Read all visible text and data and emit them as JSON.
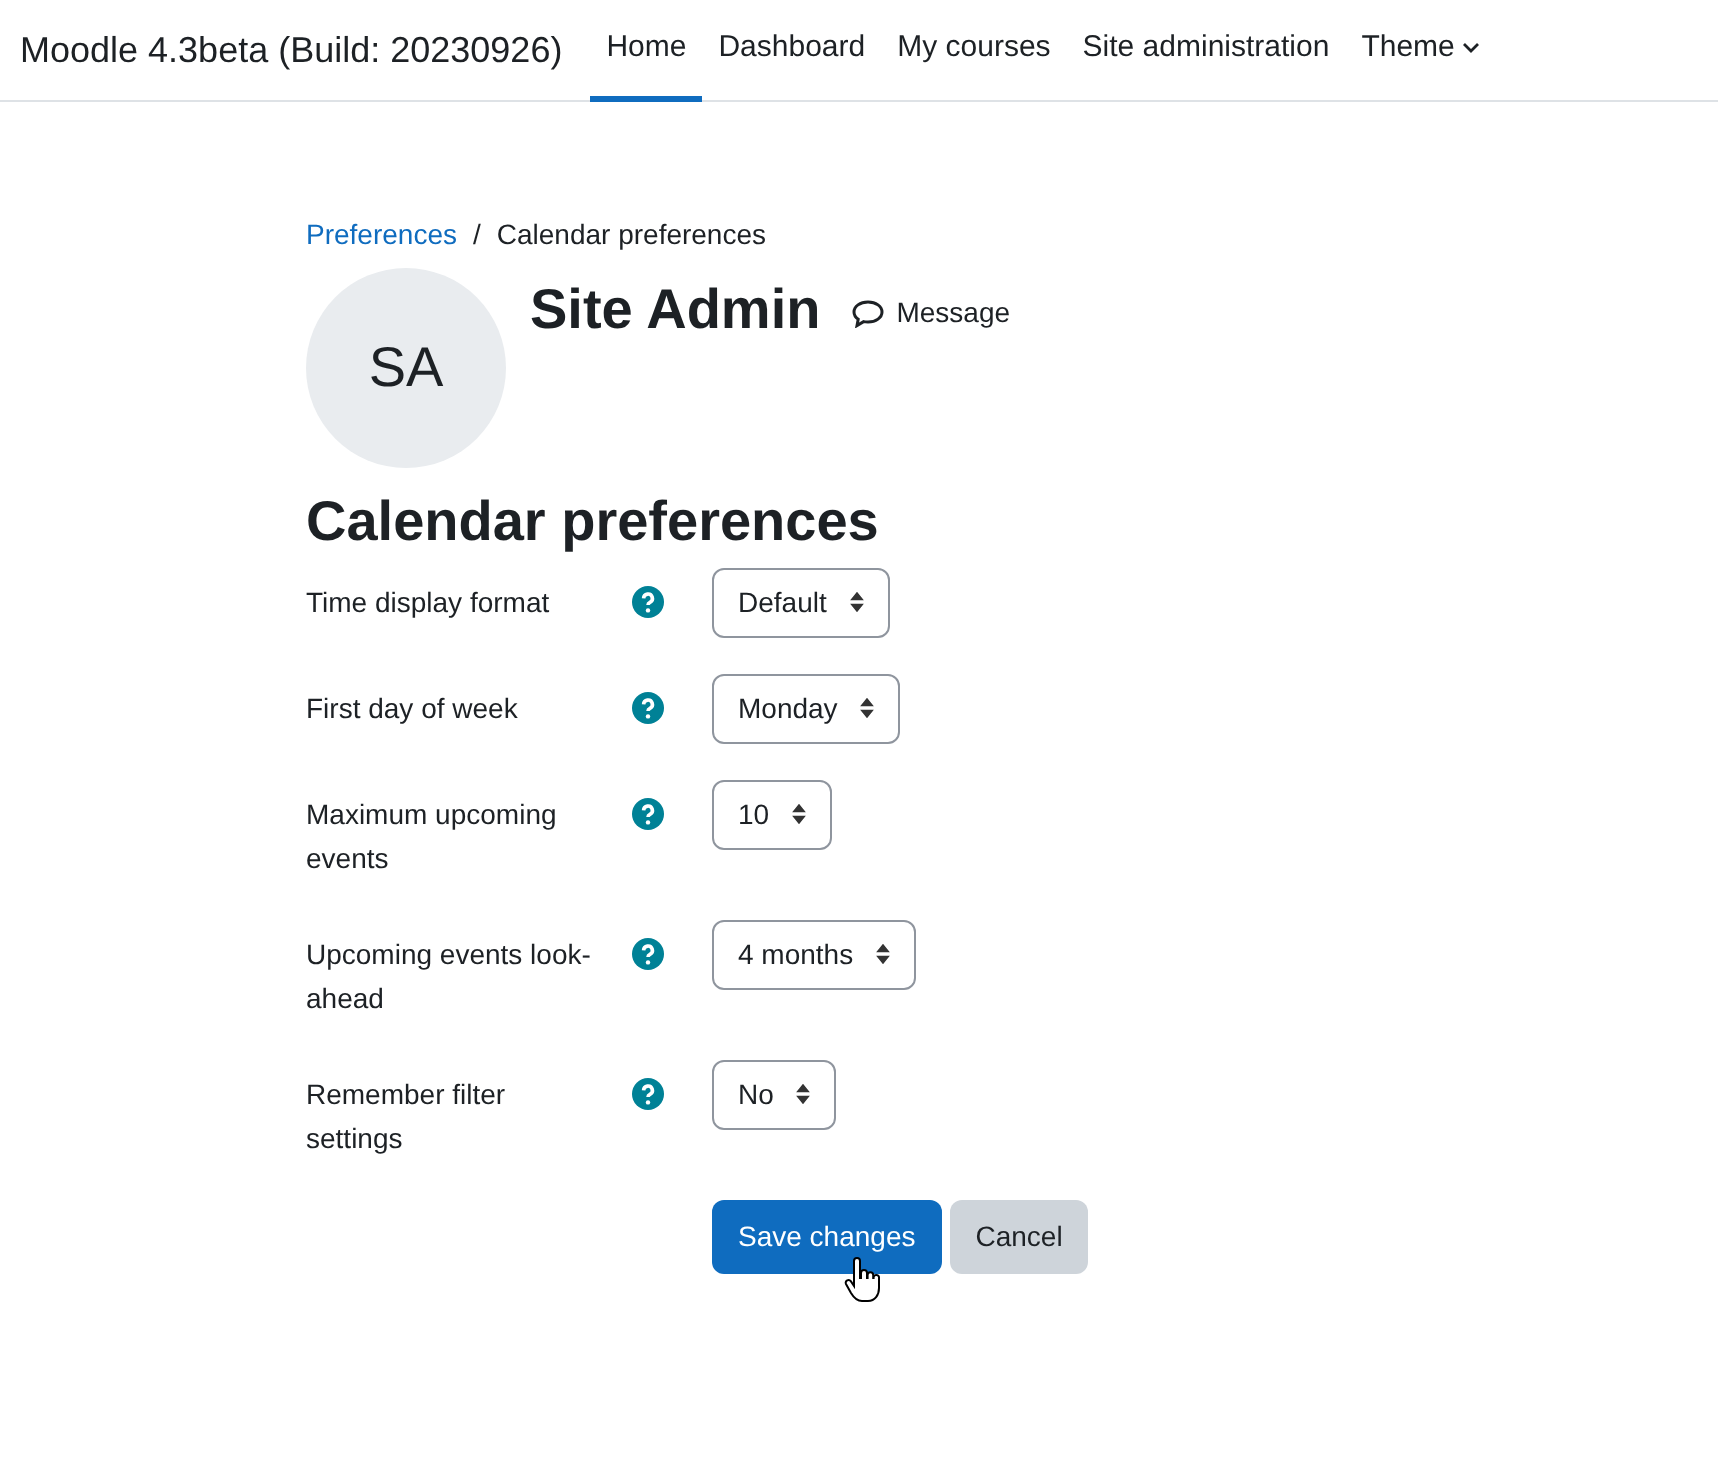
{
  "navbar": {
    "brand": "Moodle 4.3beta (Build: 20230926)",
    "links": [
      {
        "label": "Home",
        "selected": true,
        "kind": "link"
      },
      {
        "label": "Dashboard",
        "selected": false,
        "kind": "link"
      },
      {
        "label": "My courses",
        "selected": false,
        "kind": "link"
      },
      {
        "label": "Site administration",
        "selected": false,
        "kind": "link"
      },
      {
        "label": "Theme",
        "selected": false,
        "kind": "dropdown"
      }
    ]
  },
  "breadcrumb_separator": "/",
  "breadcrumb": [
    {
      "label": "Preferences",
      "kind": "link"
    },
    {
      "label": "Calendar preferences",
      "kind": "current"
    }
  ],
  "profile": {
    "initials": "SA",
    "name": "Site Admin",
    "message": "Message"
  },
  "heading": "Calendar preferences",
  "fields": [
    {
      "label": "Time display format",
      "value": "Default"
    },
    {
      "label": "First day of week",
      "value": "Monday"
    },
    {
      "label": "Maximum upcoming events",
      "value": "10"
    },
    {
      "label": "Upcoming events look-ahead",
      "value": "4 months"
    },
    {
      "label": "Remember filter settings",
      "value": "No"
    }
  ],
  "buttons": [
    {
      "label": "Save changes",
      "kind": "primary"
    },
    {
      "label": "Cancel",
      "kind": "secondary"
    }
  ]
}
